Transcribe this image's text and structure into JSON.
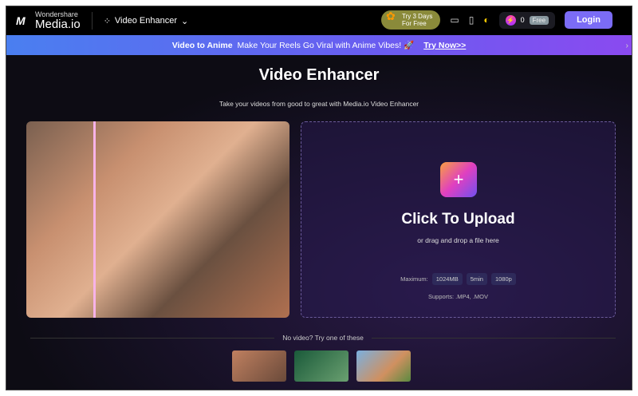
{
  "header": {
    "brand_top": "Wondershare",
    "brand_name": "Media.io",
    "product": "Video Enhancer",
    "trial": [
      "Try 3 Days",
      "For Free"
    ],
    "credits": "0",
    "plan": "Free",
    "login": "Login"
  },
  "banner": {
    "title": "Video to Anime",
    "text": "Make Your Reels Go Viral with Anime Vibes! 🚀",
    "cta": "Try Now>>"
  },
  "main": {
    "title": "Video Enhancer",
    "subtitle": "Take your videos from good to great with Media.io Video Enhancer",
    "upload": {
      "title": "Click To Upload",
      "subtitle": "or drag and drop a file here",
      "max_label": "Maximum:",
      "limits": [
        "1024MB",
        "5min",
        "1080p"
      ],
      "supports": "Supports: .MP4, .MOV"
    },
    "samples_label": "No video? Try one of these"
  },
  "colors": {
    "accent": "#7b6cf6",
    "split_line": "#f7b3e8"
  }
}
